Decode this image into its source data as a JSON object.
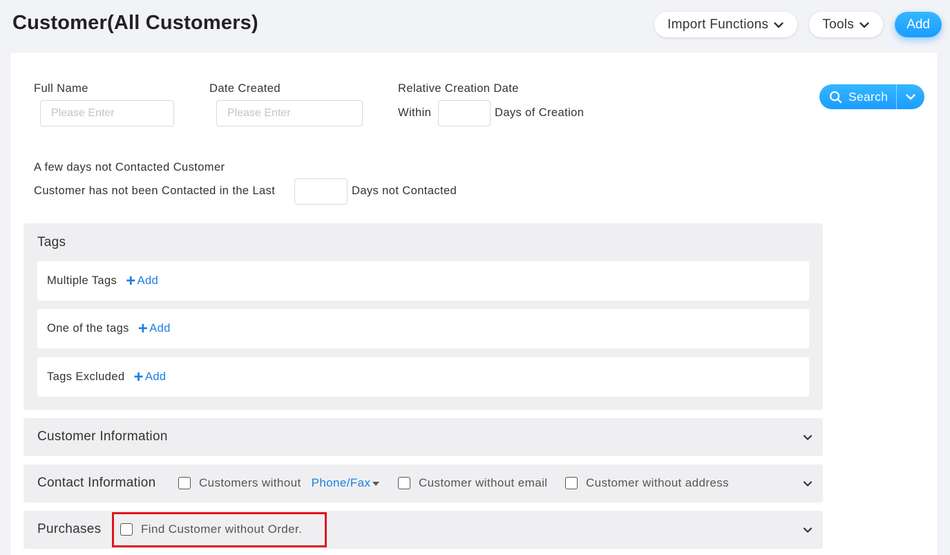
{
  "header": {
    "title": "Customer(All Customers)",
    "import_label": "Import Functions",
    "tools_label": "Tools",
    "add_label": "Add"
  },
  "filters": {
    "full_name": {
      "label": "Full Name",
      "placeholder": "Please Enter"
    },
    "date_created": {
      "label": "Date Created",
      "placeholder": "Please Enter"
    },
    "relative": {
      "label": "Relative Creation Date",
      "prefix": "Within",
      "suffix": "Days of Creation"
    },
    "not_contacted": {
      "title": "A few days not Contacted Customer",
      "prefix": "Customer has not been Contacted in the Last",
      "suffix": "Days not Contacted"
    },
    "search_label": "Search"
  },
  "tags": {
    "title": "Tags",
    "add_label": "Add",
    "rows": [
      "Multiple Tags",
      "One of the tags",
      "Tags Excluded"
    ]
  },
  "customer_info": {
    "title": "Customer Information"
  },
  "contact_info": {
    "title": "Contact Information",
    "without_phone": "Customers without",
    "phone_fax": "Phone/Fax",
    "without_email": "Customer without email",
    "without_address": "Customer without address"
  },
  "purchases": {
    "title": "Purchases",
    "without_order": "Find Customer without Order."
  },
  "colors": {
    "accent": "#1a9cff",
    "link": "#1a7fe6",
    "highlight": "#e0141e"
  }
}
